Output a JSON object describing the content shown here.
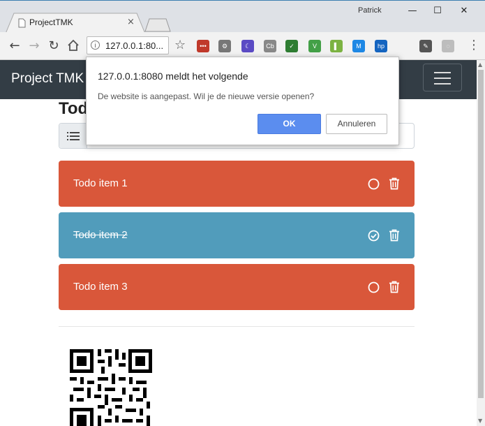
{
  "browser": {
    "tab_title": "ProjectTMK",
    "tab_close": "×",
    "user_name": "Patrick",
    "address": "127.0.0.1:80...",
    "address_info": "i",
    "extensions": [
      {
        "icon": "ext-red-dots-icon",
        "color": "#c0392b",
        "text": "•••"
      },
      {
        "icon": "ext-gear-icon",
        "color": "#777777",
        "text": "⚙"
      },
      {
        "icon": "ext-moon-icon",
        "color": "#5b4bc4",
        "text": "☾"
      },
      {
        "icon": "ext-cb-icon",
        "color": "#888888",
        "text": "Cb"
      },
      {
        "icon": "ext-check-icon",
        "color": "#2e7d32",
        "text": "✓"
      },
      {
        "icon": "ext-v-icon",
        "color": "#43a047",
        "text": "V"
      },
      {
        "icon": "ext-book-icon",
        "color": "#7cb342",
        "text": "▌"
      },
      {
        "icon": "ext-m-icon",
        "color": "#1e88e5",
        "text": "M"
      },
      {
        "icon": "ext-hp-icon",
        "color": "#1565c0",
        "text": "hp"
      },
      {
        "icon": "ext-eyedropper-icon",
        "color": "#555555",
        "text": "✎"
      },
      {
        "icon": "ext-refresh-icon",
        "color": "#bdbdbd",
        "text": "◌"
      }
    ]
  },
  "navbar": {
    "brand": "Project TMK"
  },
  "main": {
    "heading": "Todo",
    "todos": [
      {
        "label": "Todo item 1",
        "done": false,
        "color": "#d9573a"
      },
      {
        "label": "Todo item 2",
        "done": true,
        "color": "#519cbb"
      },
      {
        "label": "Todo item 3",
        "done": false,
        "color": "#d9573a"
      }
    ]
  },
  "dialog": {
    "title": "127.0.0.1:8080 meldt het volgende",
    "message": "De website is aangepast. Wil je de nieuwe versie openen?",
    "ok_label": "OK",
    "cancel_label": "Annuleren"
  }
}
